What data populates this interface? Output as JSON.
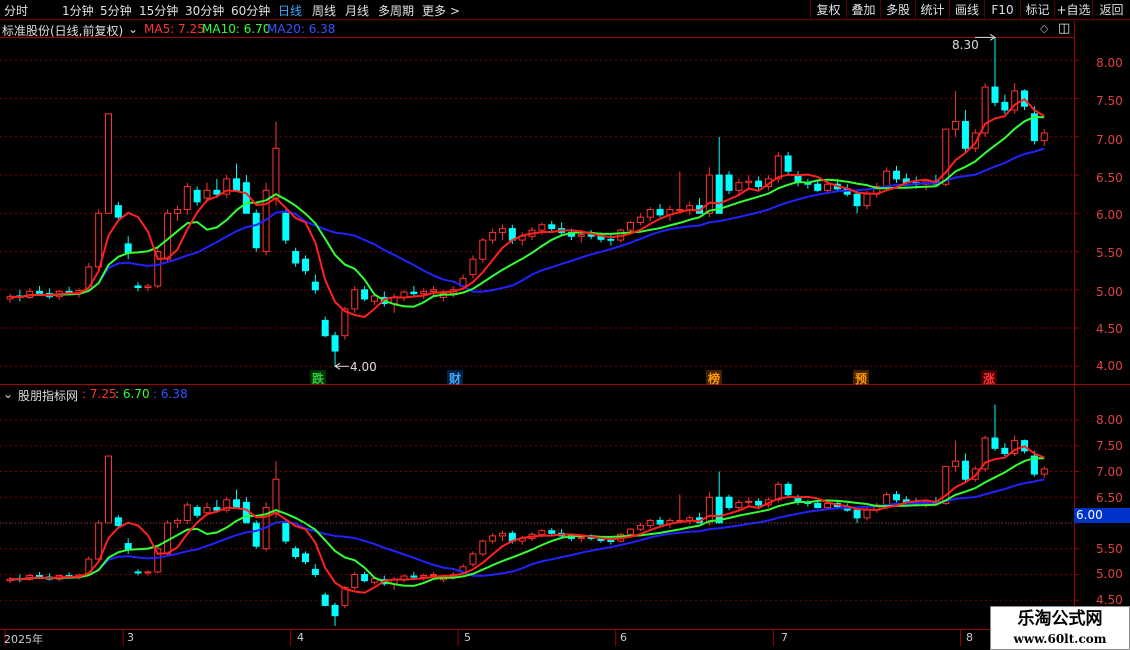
{
  "toolbar": {
    "periods": [
      "分时",
      "1分钟",
      "5分钟",
      "15分钟",
      "30分钟",
      "60分钟",
      "日线",
      "周线",
      "月线",
      "多周期",
      "更多 >"
    ],
    "active_period": "日线",
    "buttons": [
      "复权",
      "叠加",
      "多股",
      "统计",
      "画线",
      "F10",
      "标记",
      "+自选",
      "返回"
    ]
  },
  "main_panel": {
    "title": "标准股份(日线,前复权)",
    "ma5_label": "MA5: 7.25",
    "ma10_label": "MA10: 6.70",
    "ma20_label": "MA20: 6.38",
    "high_label": "8.30",
    "low_label": "4.00",
    "y_ticks": [
      "8.00",
      "7.50",
      "7.00",
      "6.50",
      "6.00",
      "5.50",
      "5.00",
      "4.50",
      "4.00"
    ],
    "event_markers": [
      {
        "text": "跌",
        "color": "#2ecc40"
      },
      {
        "text": "财",
        "color": "#3fa9ff"
      },
      {
        "text": "榜",
        "color": "#ff9900"
      },
      {
        "text": "预",
        "color": "#ff9900"
      },
      {
        "text": "涨",
        "color": "#ff3333"
      }
    ]
  },
  "sub_panel": {
    "title": "股朋指标网",
    "v1": ": 7.25",
    "v2": ": 6.70",
    "v3": ": 6.38",
    "y_ticks": [
      "8.00",
      "7.50",
      "7.00",
      "6.50",
      "6.00",
      "5.50",
      "5.00",
      "4.50"
    ],
    "crosshair_value": "6.00"
  },
  "date_axis": {
    "labels": [
      "2025年",
      "3",
      "4",
      "5",
      "6",
      "7",
      "8"
    ]
  },
  "watermark": {
    "title": "乐淘公式网",
    "url": "www.60lt.com"
  },
  "colors": {
    "up": "#ff3232",
    "down": "#00ffff",
    "ma5": "#ff2020",
    "ma10": "#33ff33",
    "ma20": "#2222ff",
    "grid": "#7a0000",
    "axis": "#a00000"
  },
  "chart_data": {
    "type": "candlestick",
    "price_range_main": [
      3.9,
      8.5
    ],
    "ohlc": [
      [
        4.88,
        4.95,
        4.83,
        4.91
      ],
      [
        4.92,
        5.0,
        4.85,
        4.9
      ],
      [
        4.9,
        5.02,
        4.88,
        4.98
      ],
      [
        4.98,
        5.05,
        4.92,
        4.95
      ],
      [
        4.95,
        5.02,
        4.88,
        4.91
      ],
      [
        4.91,
        5.0,
        4.87,
        4.98
      ],
      [
        4.98,
        5.04,
        4.93,
        4.95
      ],
      [
        4.95,
        5.02,
        4.9,
        4.99
      ],
      [
        5.0,
        5.35,
        4.98,
        5.3
      ],
      [
        5.3,
        6.05,
        5.25,
        6.0
      ],
      [
        6.0,
        7.3,
        6.3,
        7.3
      ],
      [
        6.1,
        6.15,
        5.92,
        5.95
      ],
      [
        5.6,
        5.7,
        5.4,
        5.48
      ],
      [
        5.05,
        5.1,
        4.98,
        5.03
      ],
      [
        5.03,
        5.08,
        4.98,
        5.05
      ],
      [
        5.05,
        5.55,
        5.02,
        5.5
      ],
      [
        5.4,
        6.05,
        5.35,
        6.0
      ],
      [
        6.0,
        6.1,
        5.9,
        6.05
      ],
      [
        6.05,
        6.4,
        5.98,
        6.35
      ],
      [
        6.3,
        6.35,
        6.1,
        6.15
      ],
      [
        6.2,
        6.4,
        6.15,
        6.3
      ],
      [
        6.3,
        6.45,
        6.2,
        6.25
      ],
      [
        6.25,
        6.5,
        6.2,
        6.45
      ],
      [
        6.45,
        6.65,
        6.28,
        6.3
      ],
      [
        6.4,
        6.5,
        6.0,
        6.0
      ],
      [
        6.0,
        6.05,
        5.5,
        5.55
      ],
      [
        5.5,
        6.4,
        5.45,
        6.3
      ],
      [
        6.2,
        7.2,
        6.1,
        6.85
      ],
      [
        6.0,
        6.05,
        5.6,
        5.65
      ],
      [
        5.5,
        5.55,
        5.3,
        5.35
      ],
      [
        5.4,
        5.45,
        5.2,
        5.25
      ],
      [
        5.1,
        5.2,
        4.95,
        5.0
      ],
      [
        4.6,
        4.65,
        4.38,
        4.4
      ],
      [
        4.4,
        4.45,
        4.0,
        4.2
      ],
      [
        4.4,
        4.78,
        4.35,
        4.75
      ],
      [
        4.75,
        5.05,
        4.7,
        5.0
      ],
      [
        5.0,
        5.05,
        4.85,
        4.88
      ],
      [
        4.85,
        4.95,
        4.8,
        4.92
      ],
      [
        4.9,
        4.98,
        4.78,
        4.82
      ],
      [
        4.82,
        4.95,
        4.7,
        4.9
      ],
      [
        4.9,
        5.0,
        4.85,
        4.97
      ],
      [
        4.97,
        5.05,
        4.9,
        4.95
      ],
      [
        4.95,
        5.02,
        4.88,
        4.98
      ],
      [
        4.98,
        5.05,
        4.92,
        5.0
      ],
      [
        4.9,
        5.0,
        4.85,
        4.95
      ],
      [
        4.95,
        5.05,
        4.9,
        5.0
      ],
      [
        5.05,
        5.2,
        5.0,
        5.15
      ],
      [
        5.2,
        5.45,
        5.15,
        5.4
      ],
      [
        5.4,
        5.68,
        5.35,
        5.65
      ],
      [
        5.65,
        5.8,
        5.6,
        5.75
      ],
      [
        5.75,
        5.85,
        5.65,
        5.8
      ],
      [
        5.8,
        5.85,
        5.6,
        5.65
      ],
      [
        5.65,
        5.75,
        5.58,
        5.7
      ],
      [
        5.7,
        5.82,
        5.65,
        5.78
      ],
      [
        5.78,
        5.88,
        5.72,
        5.85
      ],
      [
        5.85,
        5.9,
        5.75,
        5.8
      ],
      [
        5.8,
        5.88,
        5.7,
        5.75
      ],
      [
        5.75,
        5.8,
        5.65,
        5.7
      ],
      [
        5.7,
        5.78,
        5.62,
        5.72
      ],
      [
        5.72,
        5.78,
        5.66,
        5.7
      ],
      [
        5.7,
        5.75,
        5.62,
        5.66
      ],
      [
        5.66,
        5.72,
        5.58,
        5.65
      ],
      [
        5.65,
        5.8,
        5.62,
        5.78
      ],
      [
        5.78,
        5.9,
        5.74,
        5.88
      ],
      [
        5.88,
        6.0,
        5.84,
        5.95
      ],
      [
        5.95,
        6.08,
        5.9,
        6.05
      ],
      [
        6.05,
        6.12,
        5.95,
        5.98
      ],
      [
        5.98,
        6.1,
        5.9,
        6.05
      ],
      [
        6.05,
        6.55,
        6.0,
        6.05
      ],
      [
        6.05,
        6.15,
        5.98,
        6.1
      ],
      [
        6.1,
        6.2,
        6.02,
        6.0
      ],
      [
        6.0,
        6.6,
        5.95,
        6.5
      ],
      [
        6.5,
        7.0,
        6.0,
        6.0
      ],
      [
        6.5,
        6.55,
        6.25,
        6.3
      ],
      [
        6.3,
        6.45,
        6.22,
        6.4
      ],
      [
        6.4,
        6.5,
        6.3,
        6.42
      ],
      [
        6.42,
        6.48,
        6.3,
        6.35
      ],
      [
        6.35,
        6.5,
        6.3,
        6.45
      ],
      [
        6.45,
        6.8,
        6.4,
        6.75
      ],
      [
        6.75,
        6.8,
        6.5,
        6.55
      ],
      [
        6.5,
        6.55,
        6.35,
        6.4
      ],
      [
        6.4,
        6.45,
        6.32,
        6.38
      ],
      [
        6.38,
        6.42,
        6.28,
        6.3
      ],
      [
        6.3,
        6.42,
        6.25,
        6.38
      ],
      [
        6.38,
        6.45,
        6.28,
        6.32
      ],
      [
        6.32,
        6.38,
        6.22,
        6.25
      ],
      [
        6.25,
        6.3,
        6.0,
        6.1
      ],
      [
        6.1,
        6.3,
        6.05,
        6.25
      ],
      [
        6.25,
        6.4,
        6.2,
        6.35
      ],
      [
        6.35,
        6.6,
        6.3,
        6.55
      ],
      [
        6.55,
        6.62,
        6.4,
        6.45
      ],
      [
        6.45,
        6.52,
        6.35,
        6.4
      ],
      [
        6.4,
        6.48,
        6.32,
        6.38
      ],
      [
        6.38,
        6.45,
        6.3,
        6.42
      ],
      [
        6.42,
        6.5,
        6.35,
        6.38
      ],
      [
        6.38,
        7.1,
        6.35,
        7.1
      ],
      [
        7.1,
        7.6,
        7.0,
        7.2
      ],
      [
        7.2,
        7.35,
        6.8,
        6.85
      ],
      [
        6.85,
        7.1,
        6.8,
        7.05
      ],
      [
        7.05,
        7.7,
        7.0,
        7.65
      ],
      [
        7.65,
        8.3,
        7.4,
        7.45
      ],
      [
        7.45,
        7.55,
        7.3,
        7.35
      ],
      [
        7.35,
        7.7,
        7.3,
        7.6
      ],
      [
        7.6,
        7.62,
        7.35,
        7.4
      ],
      [
        7.3,
        7.4,
        6.9,
        6.95
      ],
      [
        6.95,
        7.1,
        6.88,
        7.05
      ]
    ]
  }
}
